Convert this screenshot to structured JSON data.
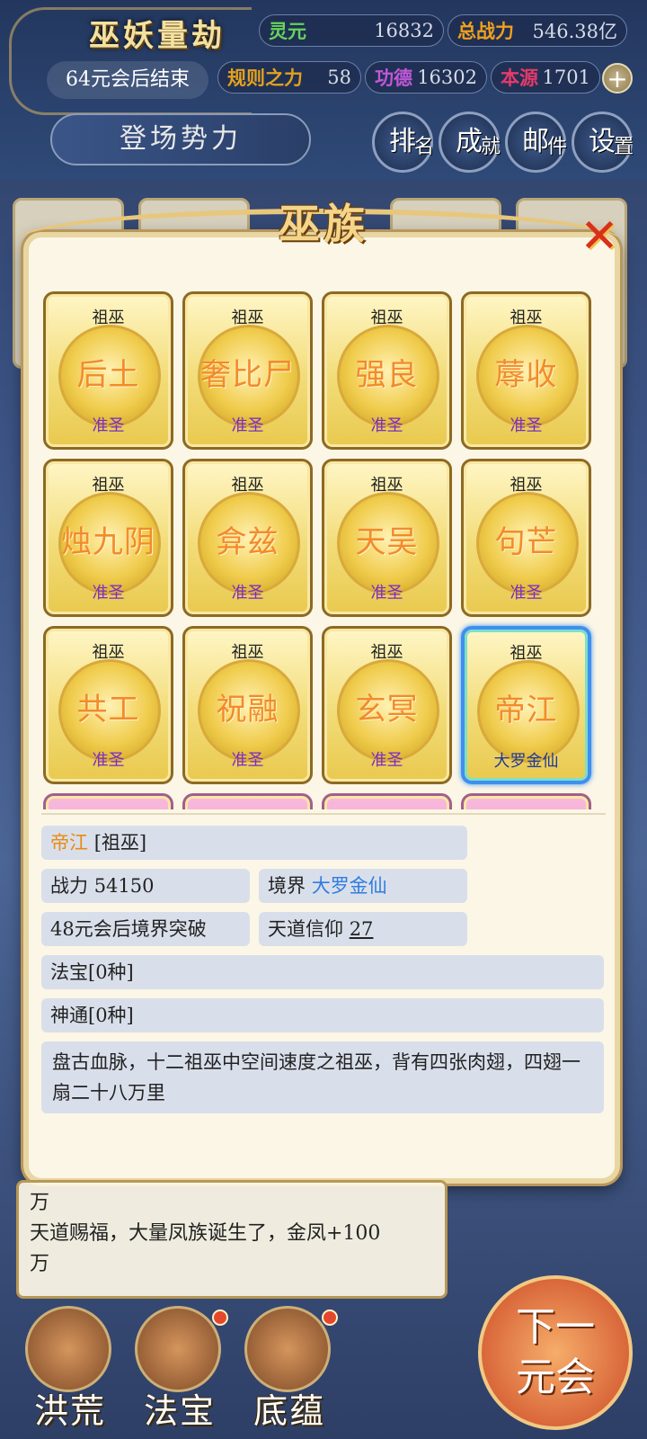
{
  "hud": {
    "game_title": "巫妖量劫",
    "countdown": "64元会后结束",
    "stats": {
      "lingyuan_label": "灵元",
      "lingyuan_value": "16832",
      "power_label": "总战力",
      "power_value": "546.38亿",
      "rule_label": "规则之力",
      "rule_value": "58",
      "merit_label": "功德",
      "merit_value": "16302",
      "origin_label": "本源",
      "origin_value": "1701"
    },
    "plus": "+",
    "faction_label": "登场势力",
    "buttons": [
      {
        "main": "排",
        "sub": "名"
      },
      {
        "main": "成",
        "sub": "就"
      },
      {
        "main": "邮",
        "sub": "件"
      },
      {
        "main": "设",
        "sub": "置"
      }
    ]
  },
  "modal": {
    "title": "巫族",
    "close": "✕",
    "cards": [
      {
        "rank": "祖巫",
        "name": "后土",
        "realm": "准圣"
      },
      {
        "rank": "祖巫",
        "name": "奢比尸",
        "realm": "准圣"
      },
      {
        "rank": "祖巫",
        "name": "强良",
        "realm": "准圣"
      },
      {
        "rank": "祖巫",
        "name": "蓐收",
        "realm": "准圣"
      },
      {
        "rank": "祖巫",
        "name": "烛九阴",
        "realm": "准圣"
      },
      {
        "rank": "祖巫",
        "name": "弇兹",
        "realm": "准圣"
      },
      {
        "rank": "祖巫",
        "name": "天吴",
        "realm": "准圣"
      },
      {
        "rank": "祖巫",
        "name": "句芒",
        "realm": "准圣"
      },
      {
        "rank": "祖巫",
        "name": "共工",
        "realm": "准圣"
      },
      {
        "rank": "祖巫",
        "name": "祝融",
        "realm": "准圣"
      },
      {
        "rank": "祖巫",
        "name": "玄冥",
        "realm": "准圣"
      },
      {
        "rank": "祖巫",
        "name": "帝江",
        "realm": "大罗金仙"
      }
    ],
    "detail": {
      "name": "帝江",
      "rank": "[祖巫]",
      "power_label": "战力",
      "power_value": "54150",
      "realm_label": "境界",
      "realm_value": "大罗金仙",
      "breakthrough": "48元会后境界突破",
      "faith_label": "天道信仰",
      "faith_value": "27",
      "treasure": "法宝[0种]",
      "ability": "神通[0种]",
      "description": "盘古血脉，十二祖巫中空间速度之祖巫，背有四张肉翅，四翅一扇二十八万里"
    }
  },
  "log": {
    "line1": "万",
    "line2": "天道赐福，大量凤族诞生了，金凤+100",
    "line3": "万"
  },
  "bottom_nav": [
    {
      "label": "洪荒"
    },
    {
      "label": "法宝"
    },
    {
      "label": "底蕴"
    }
  ],
  "next_button": {
    "line1": "下一",
    "line2": "元会"
  }
}
